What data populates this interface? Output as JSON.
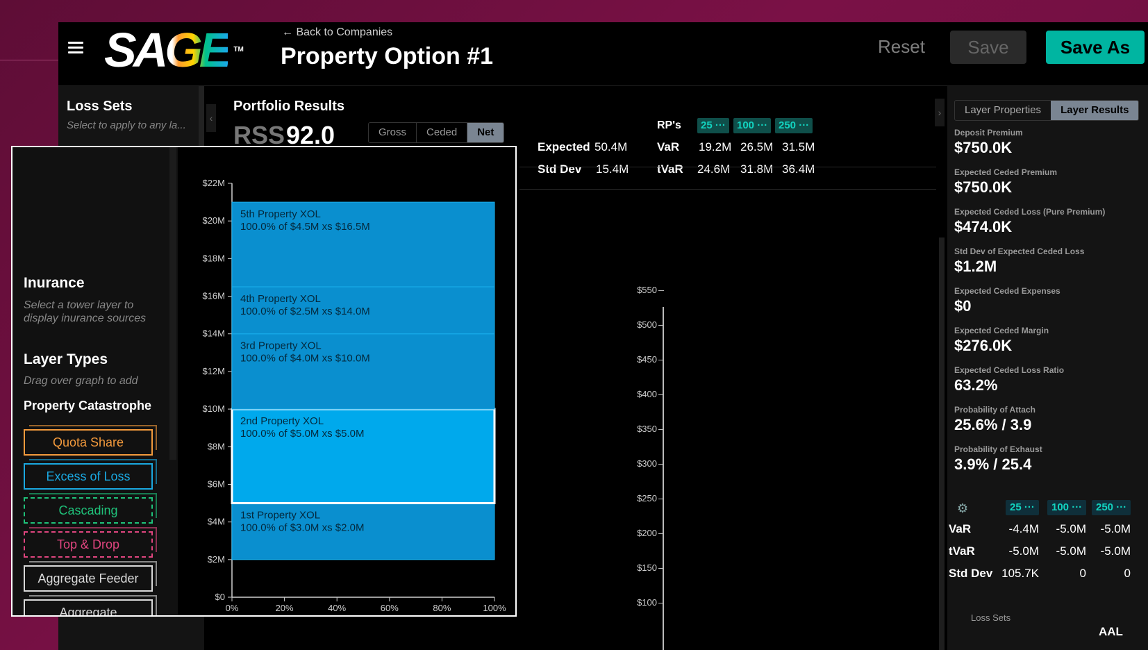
{
  "header": {
    "back_label": "← Back to Companies",
    "title": "Property Option #1",
    "reset_label": "Reset",
    "save_label": "Save",
    "save_as_label": "Save As",
    "logo_text": "SAGE",
    "logo_tm": "TM"
  },
  "left_panel": {
    "title": "Loss Sets",
    "subtitle": "Select to apply to any la..."
  },
  "portfolio": {
    "title": "Portfolio Results",
    "rss_label": "RSS",
    "rss_value": "92.0",
    "modes": [
      "Gross",
      "Ceded",
      "Net"
    ],
    "active_mode": "Net"
  },
  "stats": {
    "rps_label": "RP's",
    "rp_chips": [
      "25 ···",
      "100 ···",
      "250 ···"
    ],
    "rows": [
      {
        "label": "Expected",
        "value": "50.4M",
        "metric": "VaR",
        "rp": [
          "19.2M",
          "26.5M",
          "31.5M"
        ]
      },
      {
        "label": "Std Dev",
        "value": "15.4M",
        "metric": "tVaR",
        "rp": [
          "24.6M",
          "31.8M",
          "36.4M"
        ]
      }
    ]
  },
  "right_chart": {
    "y_ticks": [
      "$550",
      "$500",
      "$450",
      "$400",
      "$350",
      "$300",
      "$250",
      "$200",
      "$150",
      "$100"
    ]
  },
  "right_panel": {
    "tabs": [
      "Layer Properties",
      "Layer Results"
    ],
    "active_tab": "Layer Results",
    "metrics": [
      {
        "label": "Deposit Premium",
        "value": "$750.0K"
      },
      {
        "label": "Expected Ceded Premium",
        "value": "$750.0K"
      },
      {
        "label": "Expected Ceded Loss (Pure Premium)",
        "value": "$474.0K"
      },
      {
        "label": "Std Dev of Expected Ceded Loss",
        "value": "$1.2M"
      },
      {
        "label": "Expected Ceded Expenses",
        "value": "$0"
      },
      {
        "label": "Expected Ceded Margin",
        "value": "$276.0K"
      },
      {
        "label": "Expected Ceded Loss Ratio",
        "value": "63.2%"
      },
      {
        "label": "Probability of Attach",
        "value": "25.6% / 3.9"
      },
      {
        "label": "Probability of Exhaust",
        "value": "3.9% / 25.4"
      }
    ],
    "rp_chips": [
      "25 ···",
      "100 ···",
      "250 ···"
    ],
    "rp_rows": [
      {
        "label": "VaR",
        "values": [
          "-4.4M",
          "-5.0M",
          "-5.0M"
        ]
      },
      {
        "label": "tVaR",
        "values": [
          "-5.0M",
          "-5.0M",
          "-5.0M"
        ]
      },
      {
        "label": "Std Dev",
        "values": [
          "105.7K",
          "0",
          "0"
        ]
      }
    ],
    "loss_sets_label": "Loss Sets",
    "aal_label": "AAL"
  },
  "zoom_panel": {
    "insurance_title": "Inurance",
    "insurance_sub": "Select a tower layer to display inurance sources",
    "layer_types_title": "Layer Types",
    "layer_types_sub": "Drag over graph to add",
    "category": "Property Catastrophe",
    "layer_buttons": [
      {
        "label": "Quota Share",
        "color": "#f39a3c",
        "border": "solid"
      },
      {
        "label": "Excess of Loss",
        "color": "#1aa8e0",
        "border": "solid"
      },
      {
        "label": "Cascading",
        "color": "#1fc27a",
        "border": "dashed"
      },
      {
        "label": "Top & Drop",
        "color": "#e0457f",
        "border": "dashed"
      },
      {
        "label": "Aggregate Feeder",
        "color": "#d8d8d8",
        "border": "solid"
      },
      {
        "label": "Aggregate",
        "color": "#d8d8d8",
        "border": "solid"
      }
    ]
  },
  "chart_data": {
    "type": "bar",
    "y_ticks": [
      "$0",
      "$2M",
      "$4M",
      "$6M",
      "$8M",
      "$10M",
      "$12M",
      "$14M",
      "$16M",
      "$18M",
      "$20M",
      "$22M"
    ],
    "x_ticks": [
      "0%",
      "20%",
      "40%",
      "60%",
      "80%",
      "100%"
    ],
    "ylim": [
      0,
      22
    ],
    "xlim": [
      0,
      100
    ],
    "layers": [
      {
        "name": "1st Property XOL",
        "desc": "100.0% of $3.0M xs $2.0M",
        "bottom": 2.0,
        "top": 5.0,
        "share": 100,
        "selected": false
      },
      {
        "name": "2nd Property XOL",
        "desc": "100.0% of $5.0M xs $5.0M",
        "bottom": 5.0,
        "top": 10.0,
        "share": 100,
        "selected": true
      },
      {
        "name": "3rd Property XOL",
        "desc": "100.0% of $4.0M xs $10.0M",
        "bottom": 10.0,
        "top": 14.0,
        "share": 100,
        "selected": false
      },
      {
        "name": "4th Property XOL",
        "desc": "100.0% of $2.5M xs $14.0M",
        "bottom": 14.0,
        "top": 16.5,
        "share": 100,
        "selected": false
      },
      {
        "name": "5th Property XOL",
        "desc": "100.0% of $4.5M xs $16.5M",
        "bottom": 16.5,
        "top": 21.0,
        "share": 100,
        "selected": false
      }
    ],
    "colors": {
      "layer": "#0a8fcf",
      "selected": "#00a9ec",
      "text": "#04293d"
    }
  }
}
